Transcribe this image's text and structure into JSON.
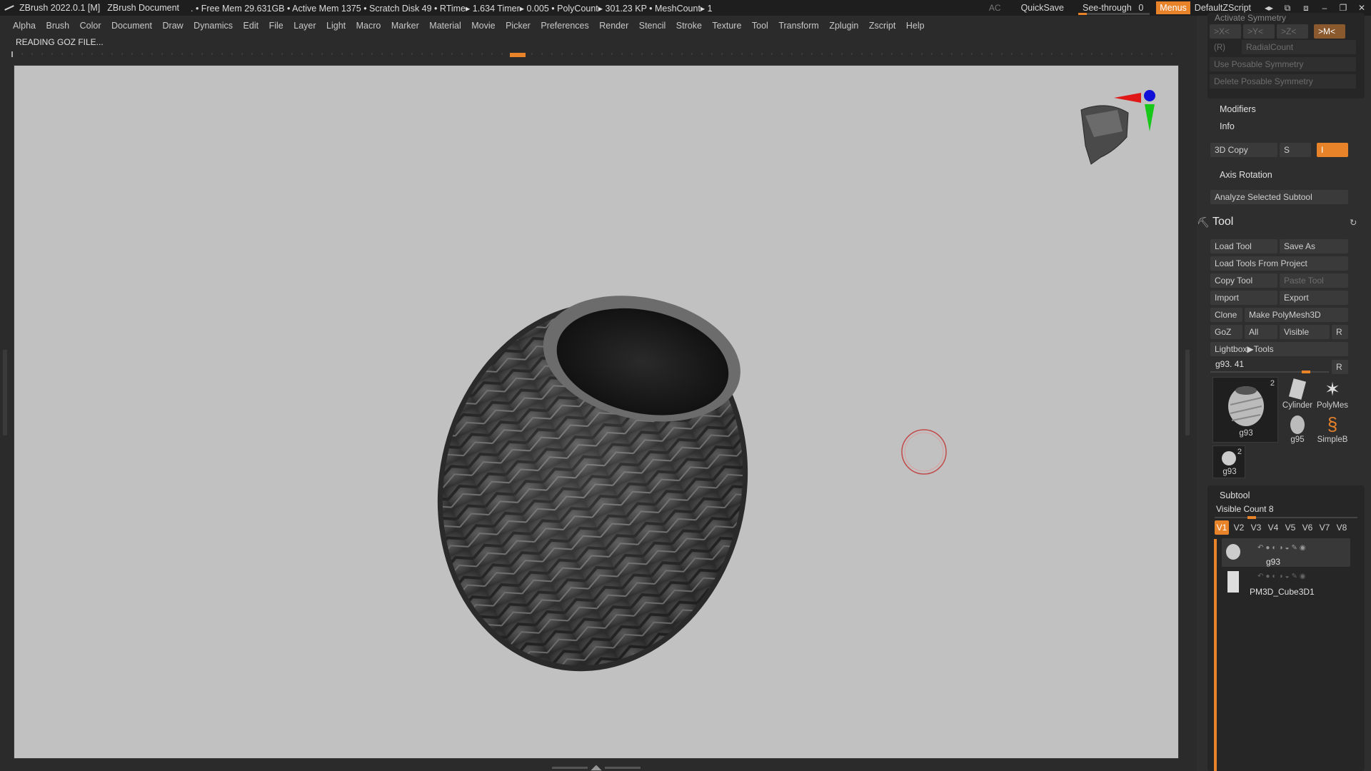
{
  "titlebar": {
    "app": "ZBrush 2022.0.1 [M]",
    "document": "ZBrush Document",
    "stats": ". • Free Mem 29.631GB • Active Mem 1375 • Scratch Disk 49 •  RTime▸ 1.634 Timer▸ 0.005 • PolyCount▸ 301.23 KP  • MeshCount▸ 1",
    "ac": "AC",
    "quicksave": "QuickSave",
    "seethrough": "See-through",
    "seethrough_value": "0",
    "menus": "Menus",
    "script": "DefaultZScript"
  },
  "menubar": [
    "Alpha",
    "Brush",
    "Color",
    "Document",
    "Draw",
    "Dynamics",
    "Edit",
    "File",
    "Layer",
    "Light",
    "Macro",
    "Marker",
    "Material",
    "Movie",
    "Picker",
    "Preferences",
    "Render",
    "Stencil",
    "Stroke",
    "Texture",
    "Tool",
    "Transform",
    "Zplugin",
    "Zscript",
    "Help"
  ],
  "status": "READING GOZ FILE...",
  "panel": {
    "activate_symmetry": "Activate Symmetry",
    "x": ">X<",
    "y": ">Y<",
    "z": ">Z<",
    "m": ">M<",
    "r": "(R)",
    "radialcount": "RadialCount",
    "use_posable": "Use Posable Symmetry",
    "delete_posable": "Delete Posable Symmetry",
    "modifiers": "Modifiers",
    "info": "Info",
    "copy3d": "3D Copy",
    "s": "S",
    "i": "I",
    "axis_rotation": "Axis Rotation",
    "analyze": "Analyze Selected Subtool",
    "tool_title": "Tool",
    "load_tool": "Load Tool",
    "save_as": "Save As",
    "load_project": "Load Tools From Project",
    "copy_tool": "Copy Tool",
    "paste_tool": "Paste Tool",
    "import": "Import",
    "export": "Export",
    "clone": "Clone",
    "make_polymesh": "Make PolyMesh3D",
    "goz": "GoZ",
    "all": "All",
    "visible": "Visible",
    "r_btn": "R",
    "lightbox": "Lightbox▶Tools",
    "current_tool": "g93. 41",
    "r_btn2": "R",
    "thumbs": {
      "main_label": "g93",
      "main_count": "2",
      "cylinder": "Cylinder",
      "polymesh": "PolyMes",
      "g95": "g95",
      "simpleb": "SimpleB",
      "small_label": "g93",
      "small_count": "2"
    },
    "subtool_title": "Subtool",
    "visible_count": "Visible Count 8",
    "vtabs": [
      "V1",
      "V2",
      "V3",
      "V4",
      "V5",
      "V6",
      "V7",
      "V8"
    ],
    "subtools": [
      "g93",
      "PM3D_Cube3D1"
    ]
  },
  "colors": {
    "accent": "#e8832a",
    "canvas": "#c1c1c1",
    "panel": "#2e2e2e"
  }
}
